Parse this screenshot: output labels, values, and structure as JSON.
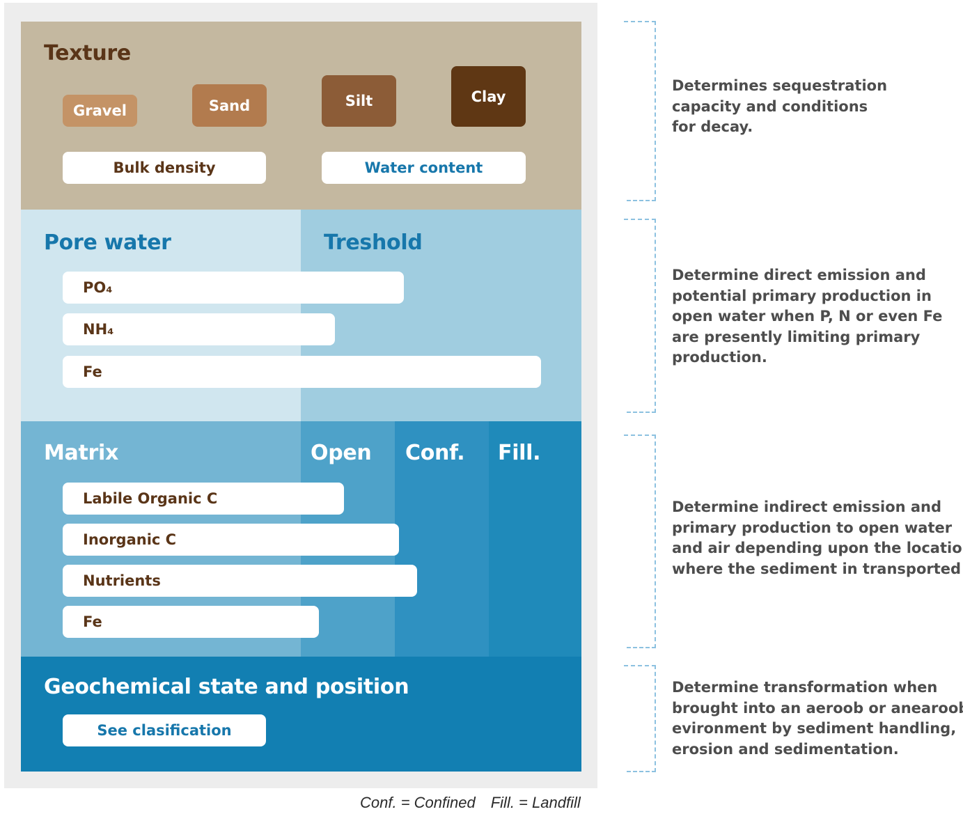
{
  "texture": {
    "title": "Texture",
    "classes": [
      {
        "label": "Gravel",
        "color": "#c49366"
      },
      {
        "label": "Sand",
        "color": "#b27b4e"
      },
      {
        "label": "Silt",
        "color": "#8c5c37"
      },
      {
        "label": "Clay",
        "color": "#5f3714"
      }
    ],
    "bulk_density": "Bulk density",
    "water_content": "Water content"
  },
  "pore_water": {
    "title": "Pore water",
    "threshold_title": "Treshold",
    "items": [
      "PO₄",
      "NH₄",
      "Fe"
    ]
  },
  "matrix": {
    "title": "Matrix",
    "columns": [
      "Open",
      "Conf.",
      "Fill."
    ],
    "items": [
      "Labile Organic C",
      "Inorganic C",
      "Nutrients",
      "Fe"
    ]
  },
  "geochemical": {
    "title": "Geochemical state and position",
    "link": "See clasification"
  },
  "notes": [
    [
      "Determines sequestration",
      "capacity and conditions",
      "for decay."
    ],
    [
      "Determine direct emission and",
      "potential primary production in",
      "open water when P, N or even Fe",
      "are presently limiting primary",
      "production."
    ],
    [
      "Determine indirect emission and",
      "primary production to open water",
      "and air depending upon the location",
      "where the sediment in transported to."
    ],
    [
      "Determine transformation when",
      "brought into an aeroob or anearoob",
      "evironment by sediment handling,",
      "erosion and sedimentation."
    ]
  ],
  "footnote": [
    "Conf. = Confined",
    "Fill. = Landfill"
  ],
  "colors": {
    "texture_bg": "#c4b8a0",
    "pore_bg": "#d0e6ef",
    "threshold_bg": "#a0cde0",
    "matrix_bg": "#74b5d3",
    "open_bg": "#4ea2c9",
    "conf_bg": "#2f91c1",
    "fill_bg": "#1f8aba",
    "geo_bg": "#127fb2",
    "heading_brown": "#5a3518",
    "heading_blue": "#1777ab"
  }
}
